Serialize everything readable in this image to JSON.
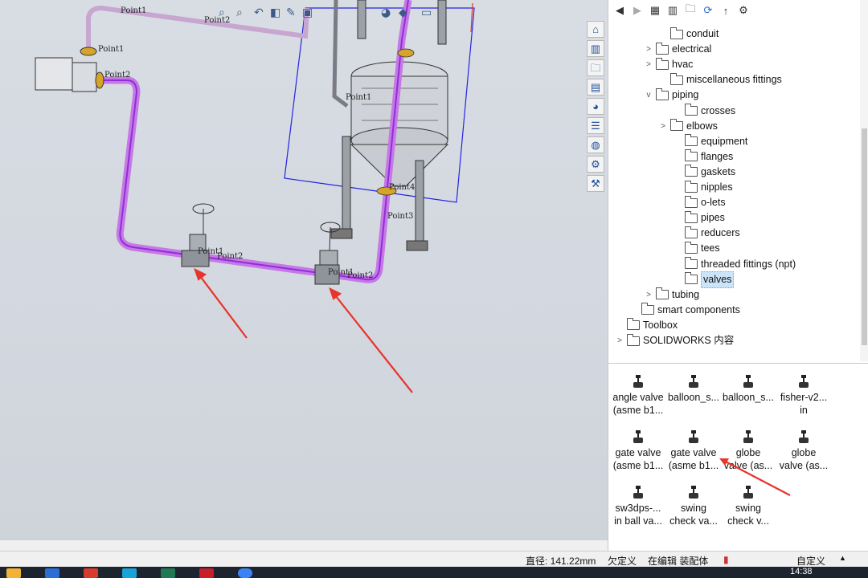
{
  "viewport": {
    "labels": {
      "point1_motor": "Point1",
      "point2_motor": "Point2",
      "point1_valve_left": "Point1",
      "point2_valve_left": "Point2",
      "point1_valve_right": "Point1",
      "point2_valve_right": "Point2",
      "point1_top": "Point1",
      "point2_top": "Point2",
      "point1_tank": "Point1",
      "point3_tank": "Point3",
      "point4_tank": "Point4"
    }
  },
  "taskpane": {
    "toolbar_icons": [
      "back-icon",
      "forward-icon",
      "add-library-icon",
      "add-file-location-icon",
      "create-folder-icon",
      "refresh-icon",
      "up-icon",
      "toolbox-icon"
    ],
    "tree": [
      {
        "label": "conduit",
        "expander": ""
      },
      {
        "label": "electrical",
        "expander": ">"
      },
      {
        "label": "hvac",
        "expander": ">"
      },
      {
        "label": "miscellaneous fittings",
        "expander": ""
      },
      {
        "label": "piping",
        "expander": "v"
      },
      {
        "label": "crosses",
        "expander": ""
      },
      {
        "label": "elbows",
        "expander": ">"
      },
      {
        "label": "equipment",
        "expander": ""
      },
      {
        "label": "flanges",
        "expander": ""
      },
      {
        "label": "gaskets",
        "expander": ""
      },
      {
        "label": "nipples",
        "expander": ""
      },
      {
        "label": "o-lets",
        "expander": ""
      },
      {
        "label": "pipes",
        "expander": ""
      },
      {
        "label": "reducers",
        "expander": ""
      },
      {
        "label": "tees",
        "expander": ""
      },
      {
        "label": "threaded fittings (npt)",
        "expander": ""
      },
      {
        "label": "valves",
        "expander": ""
      },
      {
        "label": "tubing",
        "expander": ">"
      },
      {
        "label": "smart components",
        "expander": ""
      },
      {
        "label": "Toolbox",
        "expander": ""
      },
      {
        "label": "SOLIDWORKS 内容",
        "expander": ">"
      }
    ],
    "palette": [
      {
        "line1": "angle valve",
        "line2": "(asme b1..."
      },
      {
        "line1": "balloon_s...",
        "line2": ""
      },
      {
        "line1": "balloon_s...",
        "line2": ""
      },
      {
        "line1": "fisher-v2...",
        "line2": "in"
      },
      {
        "line1": "gate valve",
        "line2": "(asme b1..."
      },
      {
        "line1": "gate valve",
        "line2": "(asme b1..."
      },
      {
        "line1": "globe",
        "line2": "valve (as..."
      },
      {
        "line1": "globe",
        "line2": "valve (as..."
      },
      {
        "line1": "sw3dps-...",
        "line2": "in ball va..."
      },
      {
        "line1": "swing",
        "line2": "check va..."
      },
      {
        "line1": "swing",
        "line2": "check v..."
      }
    ]
  },
  "status": {
    "diameter": "直径: 141.22mm",
    "definition": "欠定义",
    "editing": "在编辑 装配体",
    "units": "自定义"
  },
  "taskbar": {
    "time": "14:38"
  },
  "colors": {
    "pipe": "#c678e6",
    "pipe_highlight": "#8f2fd8",
    "arrow": "#e8342a",
    "bounding_box": "#2424e0"
  }
}
